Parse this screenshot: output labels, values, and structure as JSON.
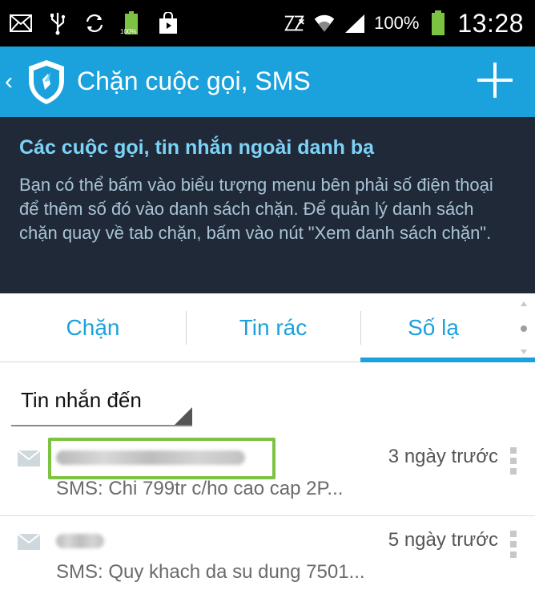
{
  "status_bar": {
    "battery_small_label": "100%",
    "battery_percent": "100%",
    "time": "13:28",
    "icons_left": [
      "mail-icon",
      "usb-icon",
      "sync-icon",
      "battery-small-icon",
      "store-icon"
    ],
    "icons_right": [
      "nfc-icon",
      "wifi-icon",
      "signal-icon",
      "battery-icon"
    ]
  },
  "action_bar": {
    "title": "Chặn cuộc gọi, SMS",
    "back_glyph": "‹",
    "color": "#1ba1dc"
  },
  "info_panel": {
    "title": "Các cuộc gọi, tin nhắn ngoài danh bạ",
    "body": "Bạn có thể bấm vào biểu tượng menu bên phải số điện thoại để thêm số đó vào danh sách chặn. Để quản lý danh sách chặn quay về tab chặn, bấm vào nút \"Xem danh sách chặn\"."
  },
  "tabs": [
    {
      "label": "Chặn",
      "active": false
    },
    {
      "label": "Tin rác",
      "active": false
    },
    {
      "label": "Số lạ",
      "active": true
    }
  ],
  "filter": {
    "selected": "Tin nhắn đến"
  },
  "messages": [
    {
      "time": "3 ngày trước",
      "preview": "SMS: Chi 799tr c/ho cao cap 2P...",
      "highlighted": true
    },
    {
      "time": "5 ngày trước",
      "preview": "SMS: Quy khach da su dung 7501...",
      "highlighted": false
    }
  ]
}
